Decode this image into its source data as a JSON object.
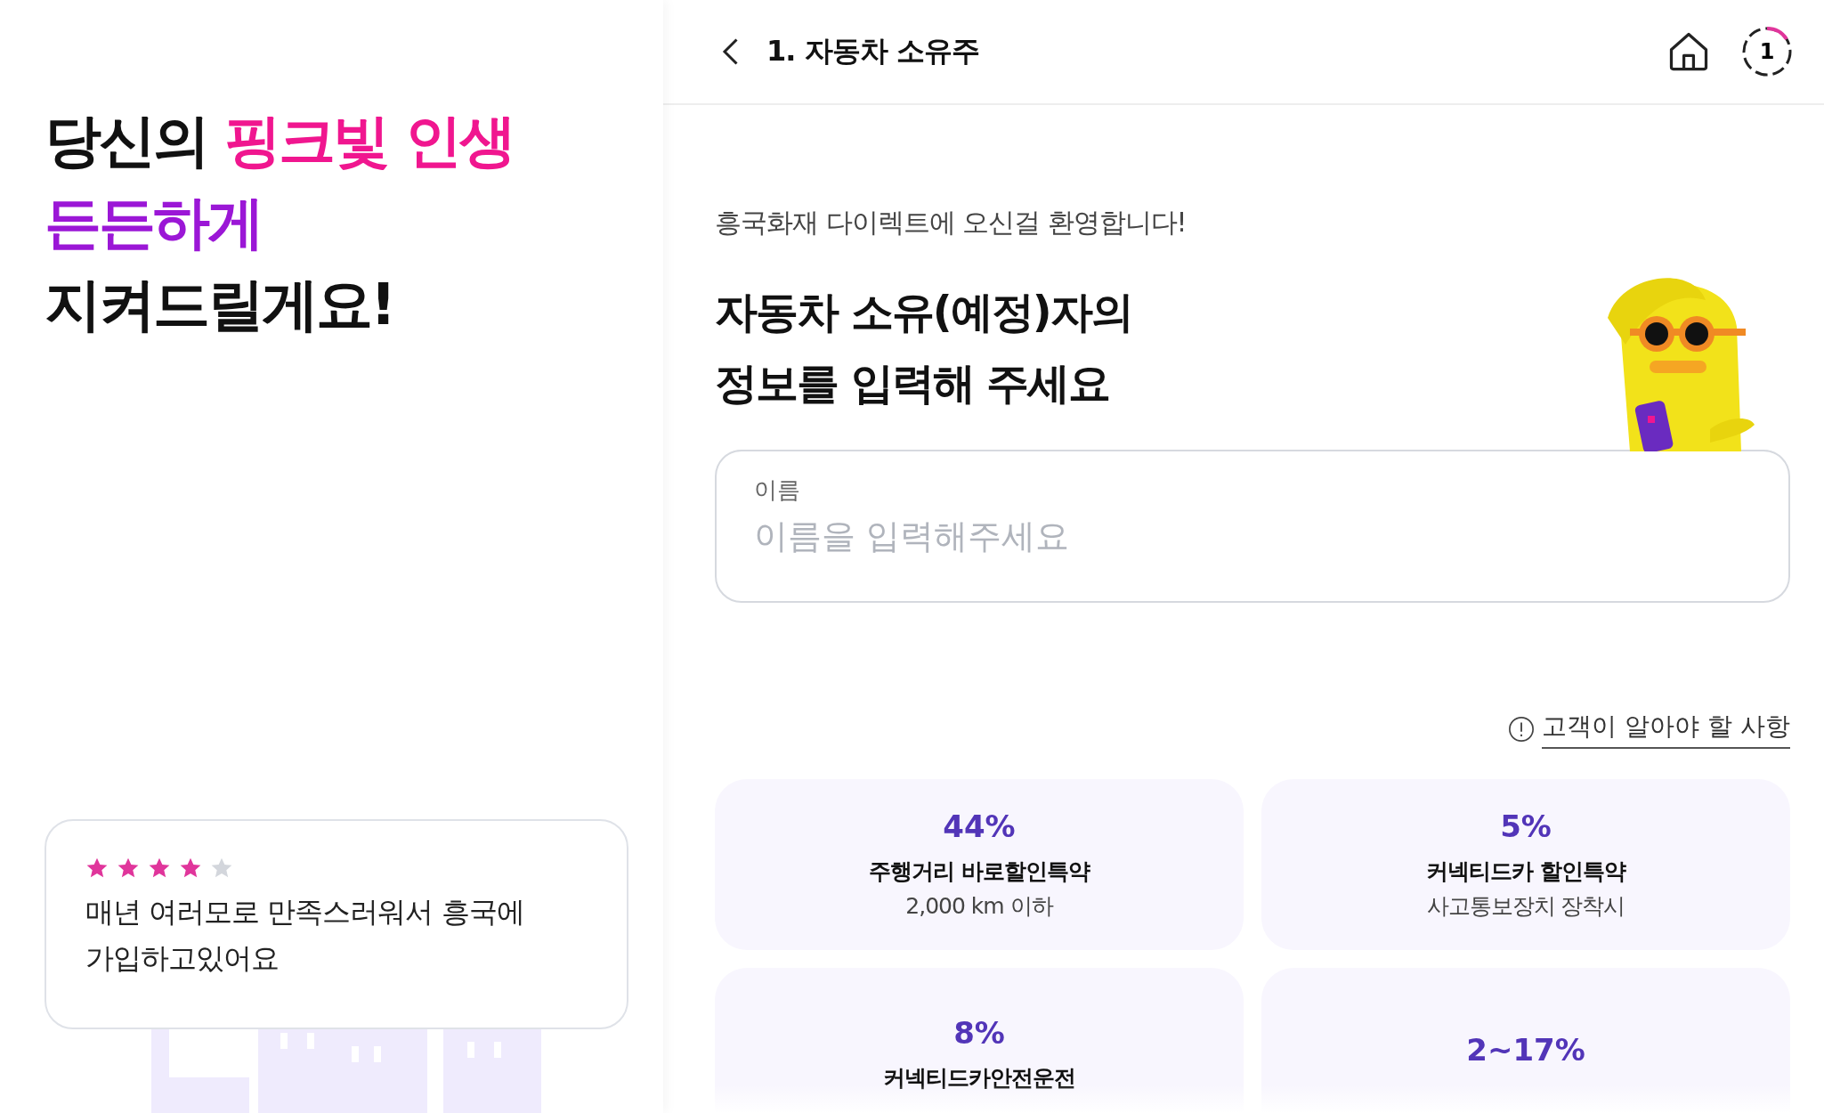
{
  "promo": {
    "headline": [
      [
        {
          "text": "당신의 ",
          "kind": "plain"
        },
        {
          "text": "핑크빛 인생",
          "kind": "pink"
        }
      ],
      [
        {
          "text": "든든하게",
          "kind": "purple"
        }
      ],
      [
        {
          "text": "지켜드릴게요!",
          "kind": "plain"
        }
      ]
    ],
    "review": {
      "stars": 4,
      "text": "매년 여러모로 만족스러워서 흥국에 가입하고있어요"
    }
  },
  "header": {
    "title": "1. 자동차 소유주",
    "step": "1"
  },
  "greeting": "흥국화재 다이렉트에 오신걸 환영합니다!",
  "heading": [
    "자동차 소유(예정)자의",
    "정보를 입력해 주세요"
  ],
  "name_field": {
    "label": "이름",
    "placeholder": "이름을 입력해주세요"
  },
  "notice_link": "고객이 알아야 할 사항",
  "discounts": [
    {
      "rate": "44%",
      "name": "주행거리 바로할인특약",
      "detail": "2,000 km 이하"
    },
    {
      "rate": "5%",
      "name": "커넥티드카 할인특약",
      "detail": "사고통보장치 장착시"
    },
    {
      "rate": "8%",
      "name": "커넥티드카안전운전"
    },
    {
      "rate": "2~17%"
    }
  ]
}
